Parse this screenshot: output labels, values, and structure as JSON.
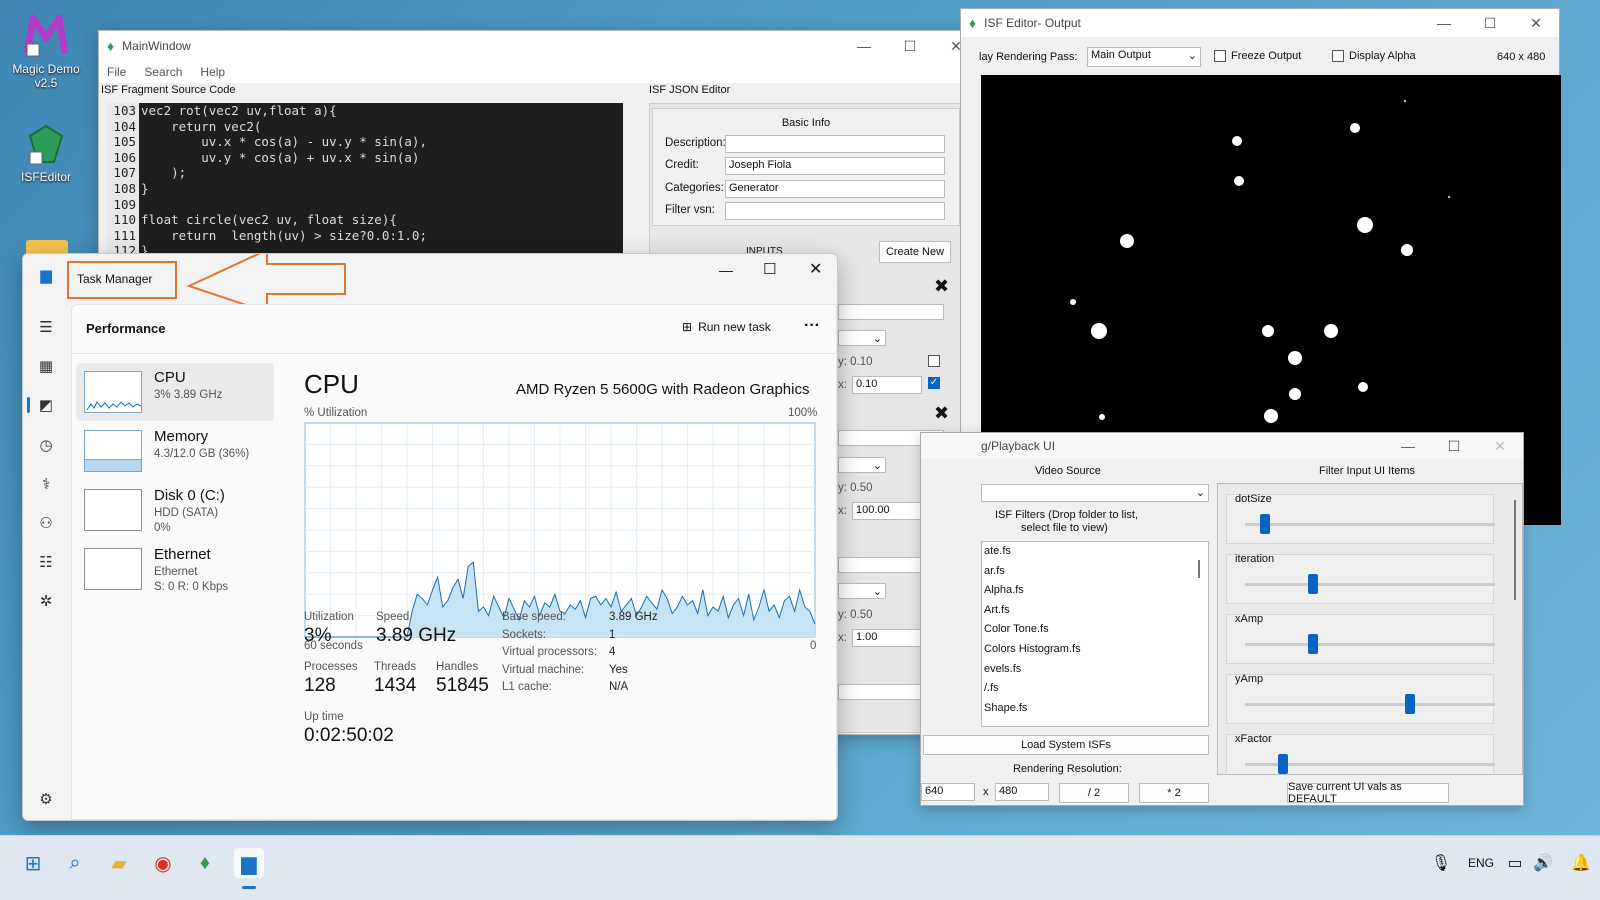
{
  "desktop": {
    "icons": [
      {
        "label": "Magic Demo v2.5"
      },
      {
        "label": "ISFEditor"
      }
    ]
  },
  "main_window": {
    "title": "MainWindow",
    "menu": [
      "File",
      "Search",
      "Help"
    ],
    "source_label": "ISF Fragment Source Code",
    "json_label": "ISF JSON Editor",
    "code_lines": [
      {
        "n": "103",
        "t": "vec2 rot(vec2 uv,float a){"
      },
      {
        "n": "104",
        "t": "    return vec2("
      },
      {
        "n": "105",
        "t": "        uv.x * cos(a) - uv.y * sin(a),"
      },
      {
        "n": "106",
        "t": "        uv.y * cos(a) + uv.x * sin(a)"
      },
      {
        "n": "107",
        "t": "    );"
      },
      {
        "n": "108",
        "t": "}"
      },
      {
        "n": "109",
        "t": ""
      },
      {
        "n": "110",
        "t": "float circle(vec2 uv, float size){"
      },
      {
        "n": "111",
        "t": "    return  length(uv) > size?0.0:1.0;"
      },
      {
        "n": "112",
        "t": "}"
      }
    ],
    "basic_info": {
      "header": "Basic Info",
      "description_label": "Description:",
      "description_value": "",
      "credit_label": "Credit:",
      "credit_value": "Joseph Fiola",
      "categories_label": "Categories:",
      "categories_value": "Generator",
      "filter_vsn_label": "Filter vsn:",
      "filter_vsn_value": ""
    },
    "inputs_label": "INPUTS",
    "create_new": "Create New",
    "input_rows": [
      {
        "a": "y: 0.10",
        "b": "x:",
        "v": "0.10"
      },
      {
        "a": "y: 0.50",
        "b": "x:",
        "v": "100.00"
      },
      {
        "a": "y: 0.50",
        "b": "x:",
        "v": "1.00"
      }
    ]
  },
  "task_manager": {
    "title": "Task Manager",
    "page": "Performance",
    "run_new_task": "Run new task",
    "more": "···",
    "resources": [
      {
        "name": "CPU",
        "s1": "3% 3.89 GHz",
        "s2": "",
        "s3": ""
      },
      {
        "name": "Memory",
        "s1": "4.3/12.0 GB (36%)",
        "s2": "",
        "s3": ""
      },
      {
        "name": "Disk 0 (C:)",
        "s1": "HDD (SATA)",
        "s2": "0%",
        "s3": ""
      },
      {
        "name": "Ethernet",
        "s1": "Ethernet",
        "s2": "S: 0 R: 0 Kbps",
        "s3": ""
      }
    ],
    "cpu": {
      "heading": "CPU",
      "model": "AMD Ryzen 5 5600G with Radeon Graphics",
      "util_label": "% Utilization",
      "max_label": "100%",
      "time_label": "60 seconds",
      "zero_label": "0",
      "samples": [
        0,
        0,
        0,
        0,
        0,
        0,
        0,
        0,
        0,
        0,
        0,
        0,
        0,
        0,
        0,
        0,
        0,
        0,
        0,
        0,
        0,
        12,
        20,
        18,
        15,
        22,
        28,
        14,
        17,
        23,
        27,
        18,
        33,
        35,
        12,
        14,
        10,
        19,
        14,
        9,
        18,
        13,
        8,
        17,
        14,
        19,
        10,
        16,
        14,
        20,
        12,
        11,
        15,
        13,
        17,
        9,
        18,
        19,
        15,
        18,
        14,
        21,
        12,
        15,
        18,
        10,
        14,
        19,
        16,
        13,
        22,
        18,
        11,
        14,
        19,
        15,
        17,
        11,
        22,
        10,
        14,
        12,
        19,
        9,
        15,
        18,
        10,
        20,
        8,
        14,
        22,
        12,
        15,
        9,
        17,
        19,
        12,
        22,
        14,
        12,
        6
      ],
      "stats": [
        {
          "label": "Utilization",
          "value": "3%"
        },
        {
          "label": "Speed",
          "value": "3.89 GHz"
        },
        {
          "label": "Processes",
          "value": "128"
        },
        {
          "label": "Threads",
          "value": "1434"
        },
        {
          "label": "Handles",
          "value": "51845"
        },
        {
          "label": "Up time",
          "value": "0:02:50:02"
        }
      ],
      "details": [
        {
          "k": "Base speed:",
          "v": "3.89 GHz"
        },
        {
          "k": "Sockets:",
          "v": "1"
        },
        {
          "k": "Virtual processors:",
          "v": "4"
        },
        {
          "k": "Virtual machine:",
          "v": "Yes"
        },
        {
          "k": "L1 cache:",
          "v": "N/A"
        }
      ]
    }
  },
  "output_window": {
    "title": "ISF Editor- Output",
    "pass_label": "lay Rendering Pass:",
    "pass_value": "Main Output",
    "freeze": "Freeze Output",
    "alpha": "Display Alpha",
    "resolution": "640 x 480"
  },
  "playback_window": {
    "title": "g/Playback UI",
    "video_source": "Video Source",
    "filter_items": "Filter Input UI Items",
    "isf_filters_1": "ISF Filters (Drop folder to list,",
    "isf_filters_2": "select file to view)",
    "files": [
      "ate.fs",
      "ar.fs",
      "Alpha.fs",
      "Art.fs",
      "Color Tone.fs",
      "Colors Histogram.fs",
      "evels.fs",
      "/.fs",
      "Shape.fs"
    ],
    "load_system": "Load System ISFs",
    "rendering_resolution": "Rendering Resolution:",
    "res_w": "640",
    "res_h": "480",
    "x_label": "x",
    "half": "/ 2",
    "double": "* 2",
    "save_default": "Save current UI vals as DEFAULT",
    "sliders": [
      {
        "label": "dotSize",
        "value": 0.08
      },
      {
        "label": "iteration",
        "value": 0.27
      },
      {
        "label": "xAmp",
        "value": 0.27
      },
      {
        "label": "yAmp",
        "value": 0.66
      },
      {
        "label": "xFactor",
        "value": 0.15
      }
    ]
  },
  "taskbar": {
    "lang": "ENG"
  }
}
